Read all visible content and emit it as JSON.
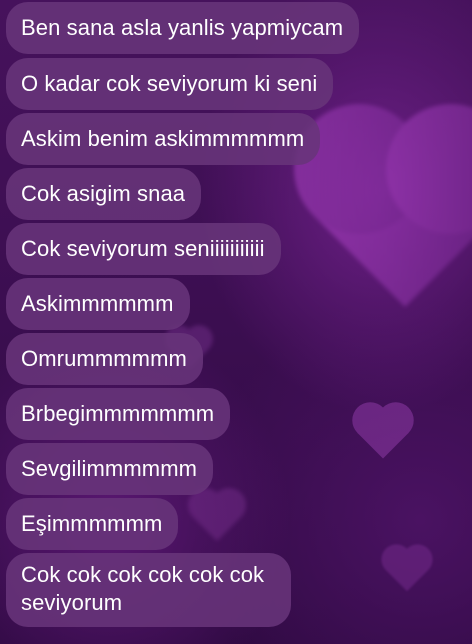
{
  "chat": {
    "messages": [
      "Ben sana asla yanlis yapmiycam",
      "O kadar cok seviyorum ki seni",
      "Askim benim askimmmmmm",
      "Cok asigim snaa",
      "Cok seviyorum seniiiiiiiiiii",
      "Askimmmmmm",
      "Omrummmmmm",
      "Brbegimmmmmmm",
      "Sevgilimmmmmm",
      "Eşimmmmmm",
      "Cok cok cok cok cok cok seviyorum"
    ]
  },
  "colors": {
    "background": "#3a0f4f",
    "bubble": "#68347a",
    "text": "#ffffff"
  }
}
